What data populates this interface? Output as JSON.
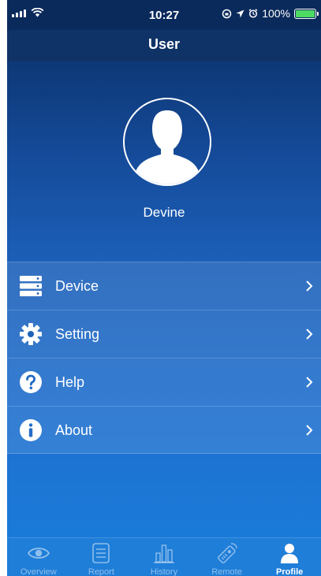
{
  "status_bar": {
    "time": "10:27",
    "battery": "100%",
    "battery_level": 1.0
  },
  "nav": {
    "title": "User"
  },
  "profile": {
    "name": "Devine"
  },
  "menu": {
    "items": [
      {
        "label": "Device",
        "icon": "server-icon"
      },
      {
        "label": "Setting",
        "icon": "gear-icon"
      },
      {
        "label": "Help",
        "icon": "help-icon"
      },
      {
        "label": "About",
        "icon": "info-icon"
      }
    ]
  },
  "tabs": {
    "items": [
      {
        "label": "Overview",
        "icon": "eye-icon"
      },
      {
        "label": "Report",
        "icon": "list-icon"
      },
      {
        "label": "History",
        "icon": "bar-chart-icon"
      },
      {
        "label": "Remote",
        "icon": "remote-icon"
      },
      {
        "label": "Profile",
        "icon": "person-icon",
        "active": true
      }
    ]
  },
  "colors": {
    "header_dark": "#0b2a5c",
    "accent": "#1a7ad8",
    "battery": "#4cd964"
  }
}
